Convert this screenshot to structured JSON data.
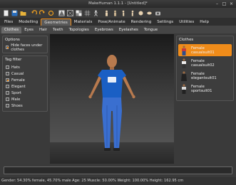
{
  "window": {
    "title": "MakeHuman 1.1.1 - [Untitled]*"
  },
  "window_controls": [
    "minimize",
    "maximize",
    "close"
  ],
  "toolbar": {
    "icons": [
      "new-file-icon",
      "save-icon",
      "load-icon",
      "undo-icon",
      "redo-icon",
      "reset-icon",
      "smooth-icon",
      "wireframe-icon",
      "background-icon",
      "grid-icon",
      "skeleton-icon",
      "front-view-icon",
      "back-view-icon",
      "left-view-icon",
      "right-view-icon",
      "top-view-icon",
      "bottom-view-icon",
      "reset-camera-icon"
    ]
  },
  "menu_tabs": [
    {
      "label": "Files"
    },
    {
      "label": "Modelling"
    },
    {
      "label": "Geometries"
    },
    {
      "label": "Materials"
    },
    {
      "label": "Pose/Animate"
    },
    {
      "label": "Rendering"
    },
    {
      "label": "Settings"
    },
    {
      "label": "Utilities"
    },
    {
      "label": "Help"
    }
  ],
  "active_menu_tab": "Geometries",
  "sub_tabs": [
    {
      "label": "Clothes"
    },
    {
      "label": "Eyes"
    },
    {
      "label": "Hair"
    },
    {
      "label": "Teeth"
    },
    {
      "label": "Topologies"
    },
    {
      "label": "Eyebrows"
    },
    {
      "label": "Eyelashes"
    },
    {
      "label": "Tongue"
    }
  ],
  "active_sub_tab": "Clothes",
  "options": {
    "title": "Options",
    "hide_faces_label": "Hide faces under clothes",
    "hide_faces_checked": true
  },
  "tag_filter": {
    "title": "Tag filter",
    "items": [
      {
        "label": "Hats",
        "checked": false
      },
      {
        "label": "Casual",
        "checked": false
      },
      {
        "label": "Female",
        "checked": true
      },
      {
        "label": "Elegant",
        "checked": false
      },
      {
        "label": "Sport",
        "checked": false
      },
      {
        "label": "Male",
        "checked": false
      },
      {
        "label": "Shoes",
        "checked": false
      }
    ]
  },
  "clothes": {
    "title": "Clothes",
    "items": [
      {
        "line1": "Female",
        "line2": "casualsuit01",
        "selected": true
      },
      {
        "line1": "Female",
        "line2": "casualsuit02",
        "selected": false
      },
      {
        "line1": "Female",
        "line2": "elegantsuit01",
        "selected": false
      },
      {
        "line1": "Female",
        "line2": "sportsuit01",
        "selected": false
      }
    ]
  },
  "bottom_input": {
    "value": ""
  },
  "status": "Gender: 54.30% female, 45.70% male Age: 25 Muscle: 50.00% Weight: 100.00% Height: 162.95 cm",
  "colors": {
    "accent": "#f08c1a",
    "shirt": "#1a5fc4",
    "jeans": "#3a6fd0",
    "skin": "#b87a4e"
  }
}
